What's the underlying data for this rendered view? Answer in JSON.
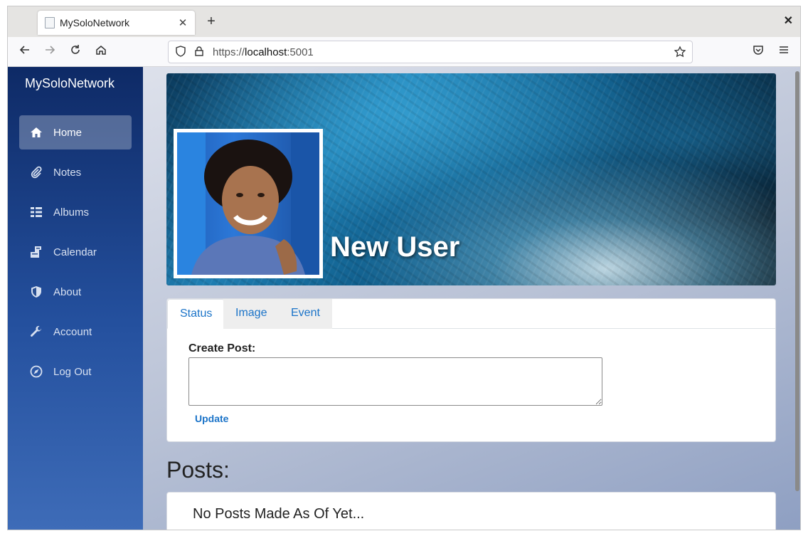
{
  "browser": {
    "tab_title": "MySoloNetwork",
    "new_tab_symbol": "+",
    "close_tab_symbol": "✕",
    "close_window_symbol": "✕",
    "url_scheme": "https://",
    "url_host": "localhost",
    "url_port": ":5001"
  },
  "sidebar": {
    "brand": "MySoloNetwork",
    "items": [
      {
        "label": "Home",
        "icon": "home-icon",
        "active": true
      },
      {
        "label": "Notes",
        "icon": "paperclip-icon",
        "active": false
      },
      {
        "label": "Albums",
        "icon": "list-icon",
        "active": false
      },
      {
        "label": "Calendar",
        "icon": "calendar-icon",
        "active": false
      },
      {
        "label": "About",
        "icon": "shield-icon",
        "active": false
      },
      {
        "label": "Account",
        "icon": "wrench-icon",
        "active": false
      },
      {
        "label": "Log Out",
        "icon": "compass-icon",
        "active": false
      }
    ]
  },
  "profile": {
    "name": "New User"
  },
  "post_form": {
    "tabs": [
      "Status",
      "Image",
      "Event"
    ],
    "active_tab": "Status",
    "label": "Create Post:",
    "value": "",
    "submit_label": "Update"
  },
  "posts": {
    "title": "Posts:",
    "empty_message": "No Posts Made As Of Yet..."
  },
  "colors": {
    "accent": "#1a73c8",
    "sidebar_top": "#0e2a66",
    "sidebar_bottom": "#3e6cb8"
  }
}
